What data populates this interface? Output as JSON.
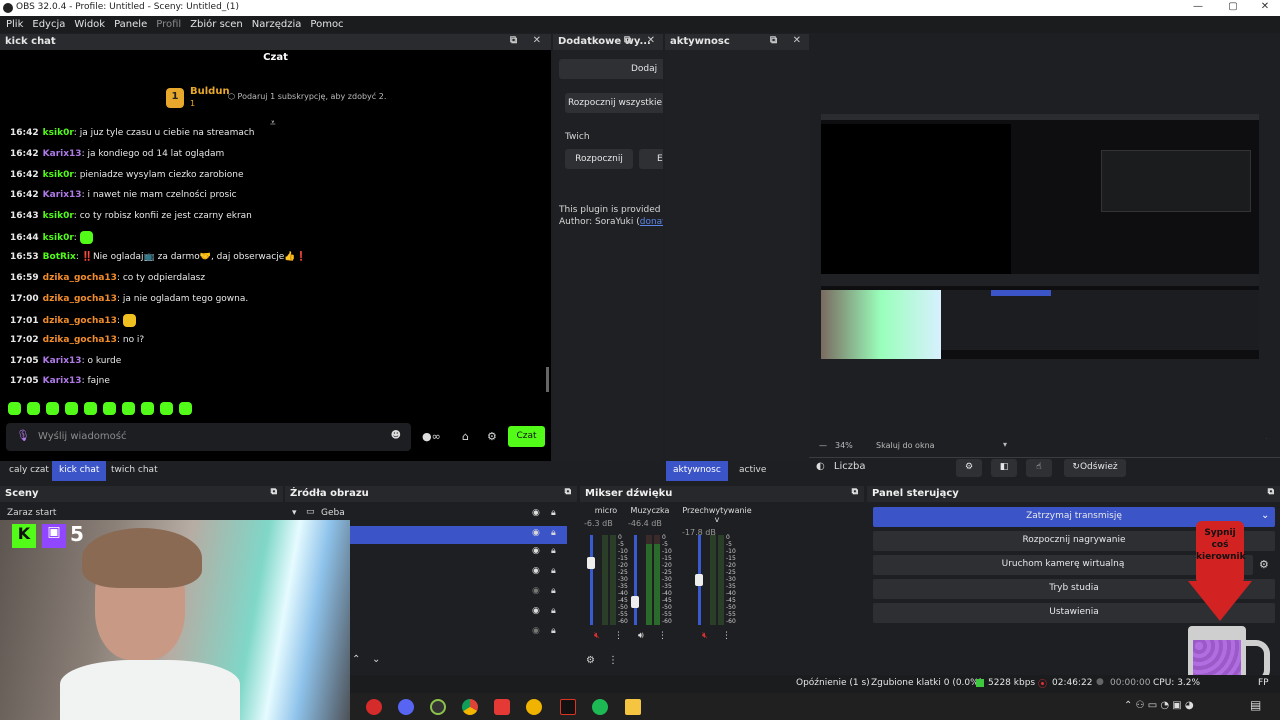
{
  "window": {
    "title": "OBS 32.0.4 - Profile: Untitled - Sceny: Untitled_(1)",
    "min": "—",
    "max": "▢",
    "close": "✕"
  },
  "menu": [
    "Plik",
    "Edycja",
    "Widok",
    "Panele",
    "Profil",
    "Zbiór scen",
    "Narzędzia",
    "Pomoc"
  ],
  "kick": {
    "dock_title": "kick chat",
    "header": "Czat",
    "leader_name": "Buldun",
    "leader_rank": "1",
    "leader_count": "1",
    "sub_text": "Podaruj 1 subskrypcję, aby zdobyć 2.",
    "messages": [
      {
        "time": "16:42",
        "user": "ksik0r",
        "color": "#53fc18",
        "text": "ja juz tyle czasu u ciebie na streamach"
      },
      {
        "time": "16:42",
        "user": "Karix13",
        "color": "#b07ae8",
        "text": "ja kondiego od 14 lat oglądam"
      },
      {
        "time": "16:42",
        "user": "ksik0r",
        "color": "#53fc18",
        "text": "pieniadze wysylam ciezko zarobione"
      },
      {
        "time": "16:42",
        "user": "Karix13",
        "color": "#b07ae8",
        "text": "i nawet nie mam czelności prosic"
      },
      {
        "time": "16:43",
        "user": "ksik0r",
        "color": "#53fc18",
        "text": "co ty robisz konfii ze jest czarny ekran"
      },
      {
        "time": "16:44",
        "user": "ksik0r",
        "color": "#53fc18",
        "text": ""
      },
      {
        "time": "16:53",
        "user": "BotRix",
        "color": "#53fc18",
        "text": "‼️Nie ogladaj📺 za darmo🤝, daj obserwacje👍❗"
      },
      {
        "time": "16:59",
        "user": "dzika_gocha13",
        "color": "#f08c2c",
        "text": "co ty odpierdalasz"
      },
      {
        "time": "17:00",
        "user": "dzika_gocha13",
        "color": "#f08c2c",
        "text": "ja nie ogladam tego gowna."
      },
      {
        "time": "17:01",
        "user": "dzika_gocha13",
        "color": "#f08c2c",
        "text": ""
      },
      {
        "time": "17:02",
        "user": "dzika_gocha13",
        "color": "#f08c2c",
        "text": "no i?"
      },
      {
        "time": "17:05",
        "user": "Karix13",
        "color": "#b07ae8",
        "text": "o kurde"
      },
      {
        "time": "17:05",
        "user": "Karix13",
        "color": "#b07ae8",
        "text": "fajne"
      }
    ],
    "input_placeholder": "Wyślij wiadomość",
    "send_label": "Czat"
  },
  "chat_tabs": [
    "caly czat",
    "kick chat",
    "twich chat"
  ],
  "dodatkowe": {
    "title": "Dodatkowe wy...",
    "btn_dodaj": "Dodaj",
    "btn_rozpocznij_wszystkie": "Rozpocznij wszystkie",
    "section": "Twich",
    "btn_rozpocznij": "Rozpocznij",
    "btn_e": "E",
    "plugin_text": "This plugin is provided for",
    "author_label": "Author: SoraYuki (",
    "author_link": "donate",
    "author_end": ")"
  },
  "aktywnosc": {
    "title": "aktywnosc",
    "tabs": [
      "aktywnosc",
      "active"
    ]
  },
  "preview": {
    "zoom": "34%",
    "scale_label": "Skaluj do okna"
  },
  "toolbar": {
    "liczba": "Liczba",
    "refresh": "Odśwież"
  },
  "sceny": {
    "title": "Sceny",
    "items": [
      "Zaraz start"
    ]
  },
  "zrodla": {
    "title": "Źródła obrazu",
    "group": "Geba"
  },
  "mixer": {
    "title": "Mikser dźwięku",
    "channels": [
      {
        "name": "micro",
        "db": "-6.3 dB"
      },
      {
        "name": "Muzyczka",
        "db": "-46.4 dB"
      },
      {
        "name": "Przechwytywanie v",
        "db": "-17.8 dB"
      }
    ],
    "scale": [
      "0",
      "-5",
      "-10",
      "-15",
      "-20",
      "-25",
      "-30",
      "-35",
      "-40",
      "-45",
      "-50",
      "-55",
      "-60"
    ]
  },
  "panel": {
    "title": "Panel sterujący",
    "buttons": [
      "Zatrzymaj transmisję",
      "Rozpocznij nagrywanie",
      "Uruchom kamerę wirtualną",
      "Tryb studia",
      "Ustawienia"
    ]
  },
  "overlay": {
    "sign_line1": "Sypnij",
    "sign_line2": "coś",
    "sign_line3": "kierownik",
    "badge_number": "5"
  },
  "status": {
    "delay": "Opóźnienie (1 s)",
    "dropped": "Zgubione klatki 0 (0.0%)",
    "bitrate": "5228 kbps",
    "live_time": "02:46:22",
    "rec_time": "00:00:00",
    "cpu": "CPU: 3.2%",
    "fps_partial": "FP"
  },
  "colors": {
    "accent": "#3b54c8",
    "kick_green": "#53fc18",
    "live_red": "#e02f2f"
  }
}
